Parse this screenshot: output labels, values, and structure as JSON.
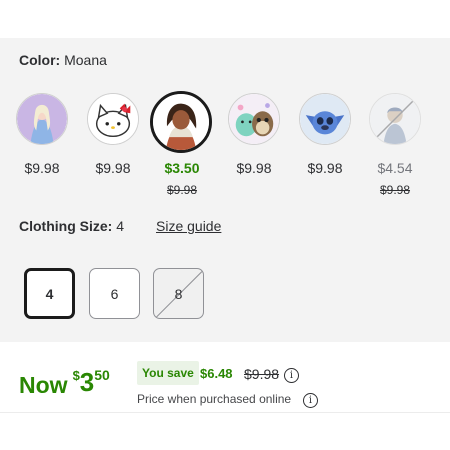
{
  "color_selector": {
    "label": "Color:",
    "value": "Moana"
  },
  "swatches": [
    {
      "name": "Elsa",
      "price": "$9.98",
      "was": "",
      "selected": false,
      "available": true
    },
    {
      "name": "Hello Kitty",
      "price": "$9.98",
      "was": "",
      "selected": false,
      "available": true
    },
    {
      "name": "Moana",
      "price": "$3.50",
      "was": "$9.98",
      "selected": true,
      "available": true
    },
    {
      "name": "Squishmallows",
      "price": "$9.98",
      "was": "",
      "selected": false,
      "available": true
    },
    {
      "name": "Stitch",
      "price": "$9.98",
      "was": "",
      "selected": false,
      "available": true
    },
    {
      "name": "Unavailable",
      "price": "$4.54",
      "was": "$9.98",
      "selected": false,
      "available": false
    }
  ],
  "size_selector": {
    "label": "Clothing Size:",
    "value": "4",
    "guide_link": "Size guide",
    "options": [
      {
        "label": "4",
        "selected": true,
        "available": true
      },
      {
        "label": "6",
        "selected": false,
        "available": true
      },
      {
        "label": "8",
        "selected": false,
        "available": false
      }
    ]
  },
  "pricing": {
    "now_word": "Now",
    "currency": "$",
    "dollars": "3",
    "cents": "50",
    "you_save_label": "You save",
    "save_amount": "$6.48",
    "original_price": "$9.98",
    "online_note": "Price when purchased online",
    "info_glyph": "i"
  },
  "colors": {
    "sale_green": "#2a8703",
    "you_save_bg": "#eaf3e6",
    "selected_border": "#1b1b1b"
  }
}
